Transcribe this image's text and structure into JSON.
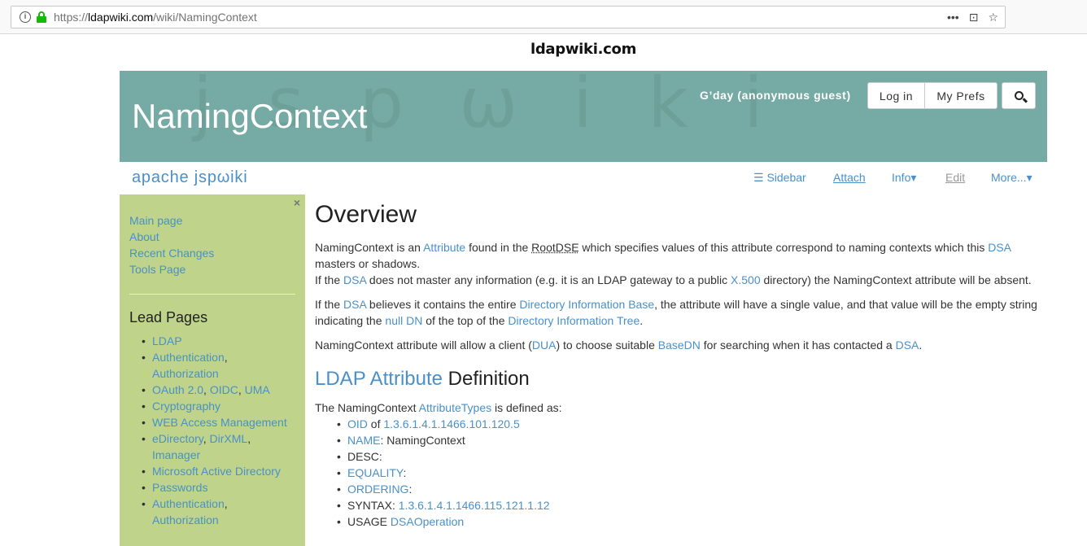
{
  "browser": {
    "url_prefix": "https://",
    "url_host": "ldapwiki.com",
    "url_path": "/wiki/NamingContext",
    "actions": [
      "•••",
      "⊡",
      "☆"
    ]
  },
  "site": {
    "name": "ldapwiki.com"
  },
  "header": {
    "title": "NamingContext",
    "watermark": "jspωiki",
    "greeting": "G’day (anonymous guest)",
    "login_label": "Log in",
    "prefs_label": "My Prefs",
    "search_icon": "search-icon"
  },
  "nav": {
    "brand": "apache jspωiki",
    "sidebar": "☰ Sidebar",
    "attach": "Attach",
    "info": "Info▾",
    "edit": "Edit",
    "more": "More...▾"
  },
  "sidebar": {
    "close": "×",
    "links": [
      "Main page",
      "About",
      "Recent Changes",
      "Tools Page"
    ],
    "heading": "Lead Pages",
    "items": {
      "ldap": "LDAP",
      "authn": "Authentication",
      "authz": "Authorization",
      "oauth": "OAuth 2.0",
      "oidc": "OIDC",
      "uma": "UMA",
      "crypto": "Cryptography",
      "webaccess": "WEB Access Management",
      "edir": "eDirectory",
      "dirxml": "DirXML",
      "imanager": "Imanager",
      "mad": "Microsoft Active Directory",
      "passwords": "Passwords",
      "authn2": "Authentication",
      "authz2": "Authorization"
    }
  },
  "content": {
    "overview_heading": "Overview",
    "p1": {
      "t1": "NamingContext is an ",
      "attribute": "Attribute",
      "t2": " found in the ",
      "rootdse": "RootDSE",
      "t3": " which specifies values of this attribute correspond to naming contexts which this ",
      "dsa": "DSA",
      "t4": " masters or shadows.",
      "t5": "If the ",
      "dsa2": "DSA",
      "t6": " does not master any information (e.g. it is an LDAP gateway to a public ",
      "x500": "X.500",
      "t7": " directory) the NamingContext attribute will be absent."
    },
    "p2": {
      "t1": "If the ",
      "dsa": "DSA",
      "t2": " believes it contains the entire ",
      "dib": "Directory Information Base",
      "t3": ", the attribute will have a single value, and that value will be the empty string indicating the ",
      "nulldn": "null DN",
      "t4": " of the top of the ",
      "dit": "Directory Information Tree",
      "t5": "."
    },
    "p3": {
      "t1": "NamingContext attribute will allow a client (",
      "dua": "DUA",
      "t2": ") to choose suitable ",
      "basedn": "BaseDN",
      "t3": " for searching when it has contacted a ",
      "dsa": "DSA",
      "t4": "."
    },
    "def_heading_link1": "LDAP",
    "def_heading_link2": "Attribute",
    "def_heading_rest": " Definition",
    "def_intro": {
      "t1": "The NamingContext ",
      "attributetypes": "AttributeTypes",
      "t2": " is defined as:"
    },
    "def": {
      "oid_label": "OID",
      "oid_of": " of ",
      "oid_value": "1.3.6.1.4.1.1466.101.120.5",
      "name_label": "NAME",
      "name_value": ": NamingContext",
      "desc": "DESC:",
      "equality_label": "EQUALITY",
      "colon": ":",
      "ordering_label": "ORDERING",
      "syntax_text": "SYNTAX: ",
      "syntax_value": "1.3.6.1.4.1.1466.115.121.1.12",
      "usage_text": "USAGE ",
      "usage_value": "DSAOperation"
    }
  }
}
